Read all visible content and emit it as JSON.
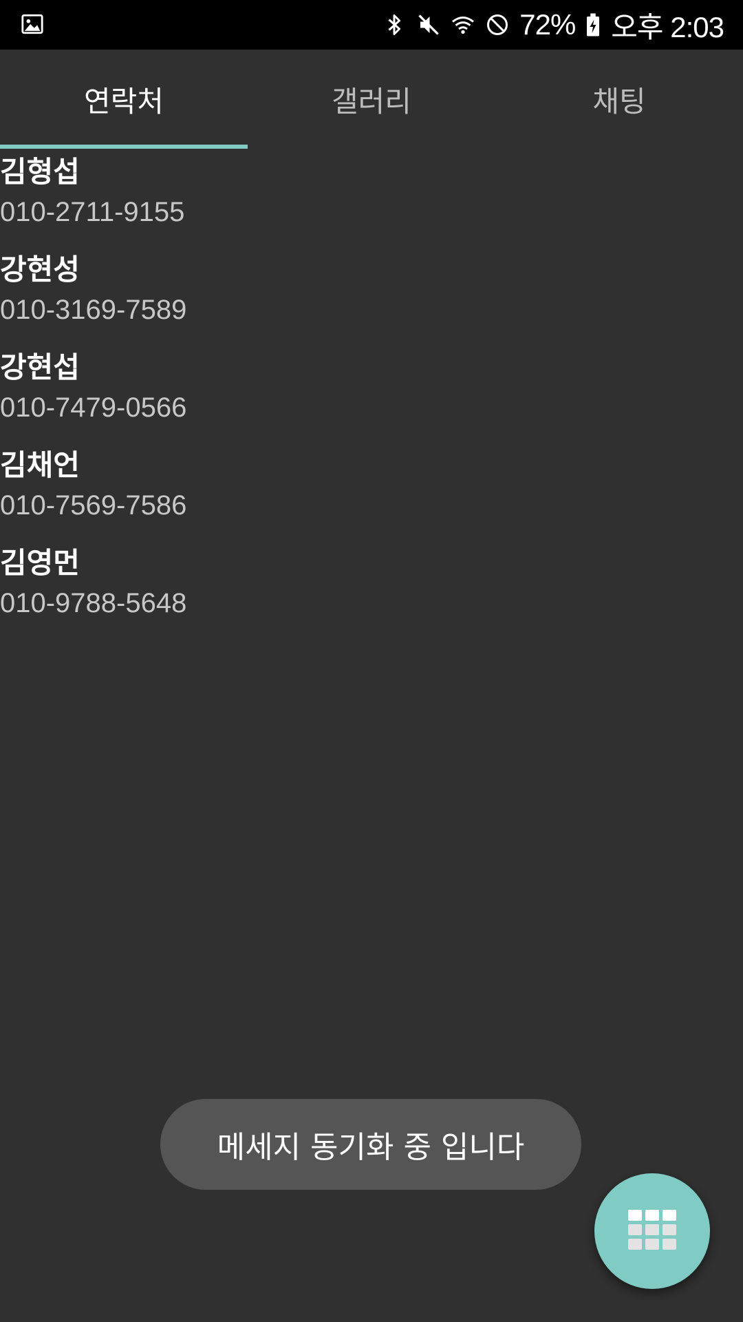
{
  "colors": {
    "accent": "#80cbc4",
    "background": "#303030",
    "statusbar": "#000000",
    "toast_bg": "#555555"
  },
  "statusbar": {
    "left_icon": "image-icon",
    "icons": [
      "bluetooth-icon",
      "mute-icon",
      "wifi-icon",
      "do-not-disturb-icon",
      "battery-charging-icon"
    ],
    "battery": "72%",
    "time": "오후 2:03"
  },
  "tabs": [
    {
      "label": "연락처",
      "active": true
    },
    {
      "label": "갤러리",
      "active": false
    },
    {
      "label": "채팅",
      "active": false
    }
  ],
  "contacts": [
    {
      "name": "김형섭",
      "phone": "010-2711-9155"
    },
    {
      "name": "강현성",
      "phone": "010-3169-7589"
    },
    {
      "name": "강현섭",
      "phone": "010-7479-0566"
    },
    {
      "name": "김채언",
      "phone": "010-7569-7586"
    },
    {
      "name": "김영먼",
      "phone": "010-9788-5648"
    }
  ],
  "toast": {
    "message": "메세지 동기화 중 입니다"
  },
  "fab": {
    "icon": "dialpad-grid-icon"
  }
}
